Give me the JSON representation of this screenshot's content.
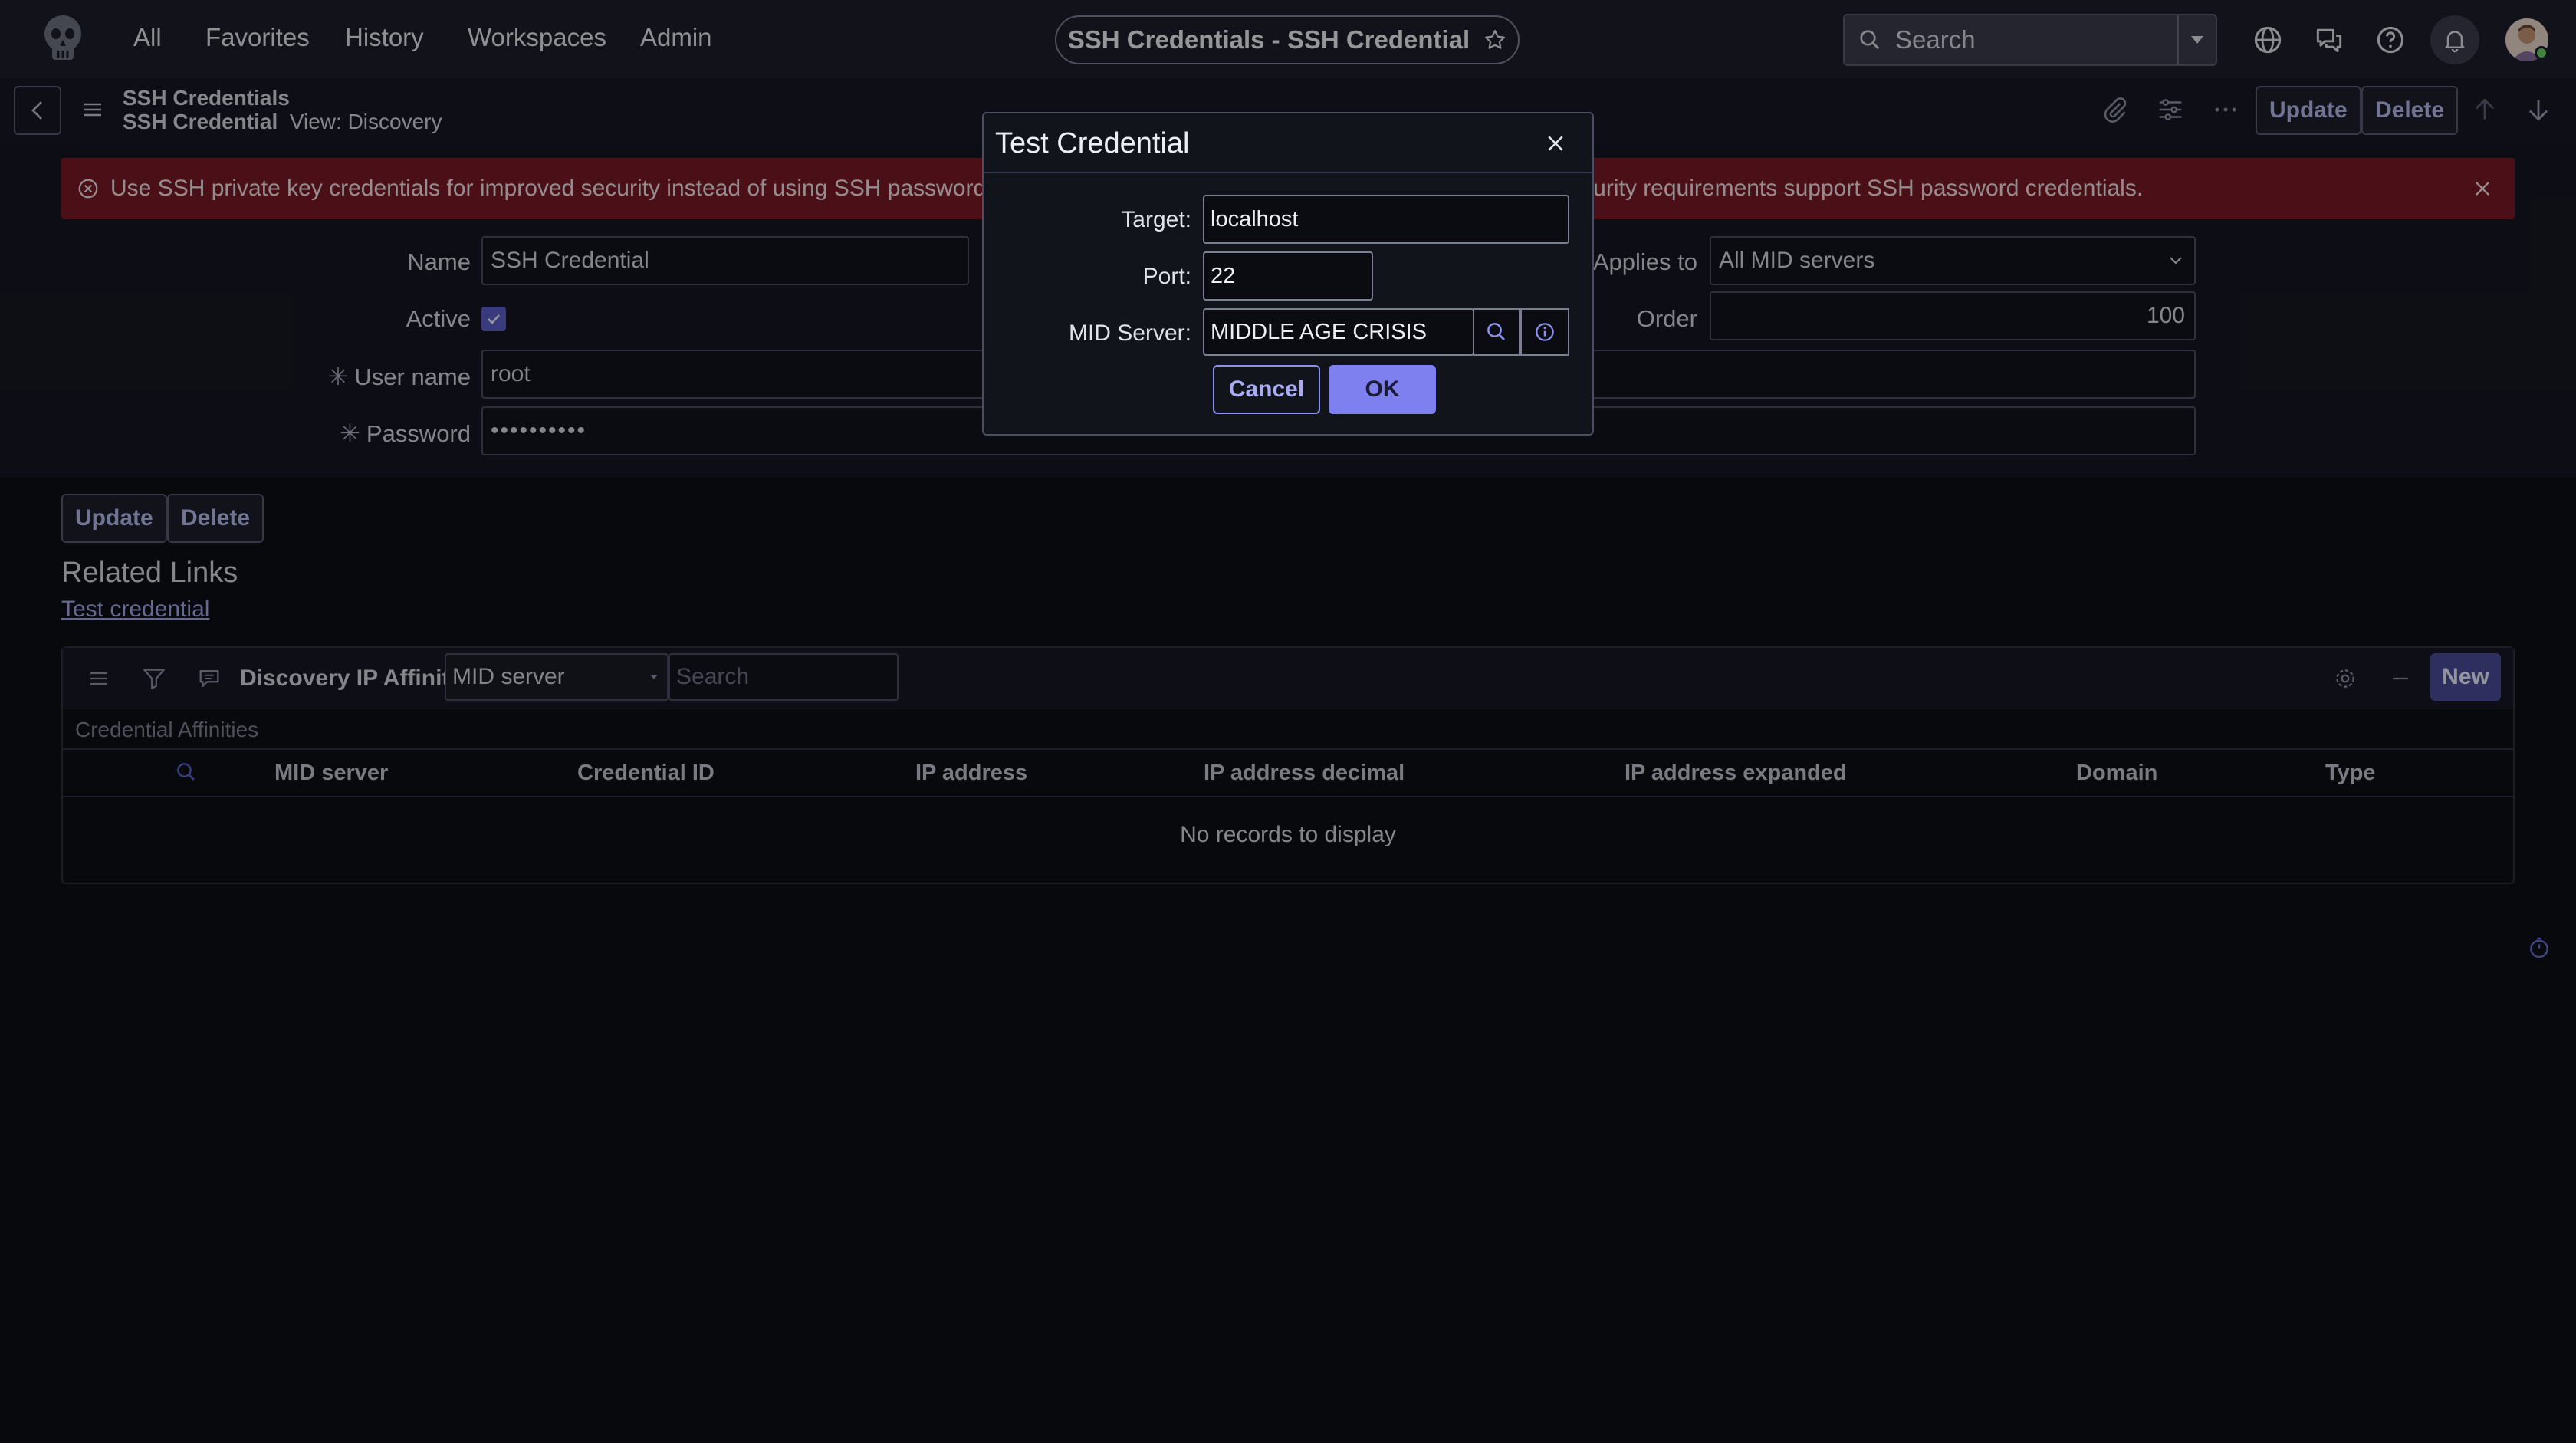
{
  "topnav": {
    "items": [
      "All",
      "Favorites",
      "History",
      "Workspaces",
      "Admin"
    ],
    "record_title": "SSH Credentials - SSH Credential",
    "search_placeholder": "Search"
  },
  "header": {
    "table": "SSH Credentials",
    "record": "SSH Credential",
    "view": "View: Discovery",
    "update_label": "Update",
    "delete_label": "Delete"
  },
  "alert": {
    "text": "Use SSH private key credentials for improved security instead of using SSH password credentials. Use SSH password credentials only if your security requirements support SSH password credentials."
  },
  "form": {
    "name_label": "Name",
    "name_value": "SSH Credential",
    "active_label": "Active",
    "user_label": "User name",
    "user_value": "root",
    "password_label": "Password",
    "password_value": "••••••••••",
    "applies_label": "Applies to",
    "applies_value": "All MID servers",
    "order_label": "Order",
    "order_value": "100",
    "required_mark": "✳"
  },
  "actions": {
    "update_label": "Update",
    "delete_label": "Delete"
  },
  "related": {
    "title": "Related Links",
    "link": "Test credential"
  },
  "list": {
    "title": "Discovery IP Affinity",
    "filter_select": "MID server",
    "search_placeholder": "Search",
    "new_label": "New",
    "subtitle": "Credential Affinities",
    "columns": [
      "MID server",
      "Credential ID",
      "IP address",
      "IP address decimal",
      "IP address expanded",
      "Domain",
      "Type"
    ],
    "empty_text": "No records to display"
  },
  "modal": {
    "title": "Test Credential",
    "target_label": "Target:",
    "target_value": "localhost",
    "port_label": "Port:",
    "port_value": "22",
    "mid_label": "MID Server:",
    "mid_value": "MIDDLE AGE CRISIS",
    "cancel_label": "Cancel",
    "ok_label": "OK"
  },
  "colors": {
    "background": "#0d0f15",
    "nav": "#1d1f2b",
    "alert": "#7a1b26",
    "accent": "#7e80ef",
    "link": "#a5a8ec"
  }
}
